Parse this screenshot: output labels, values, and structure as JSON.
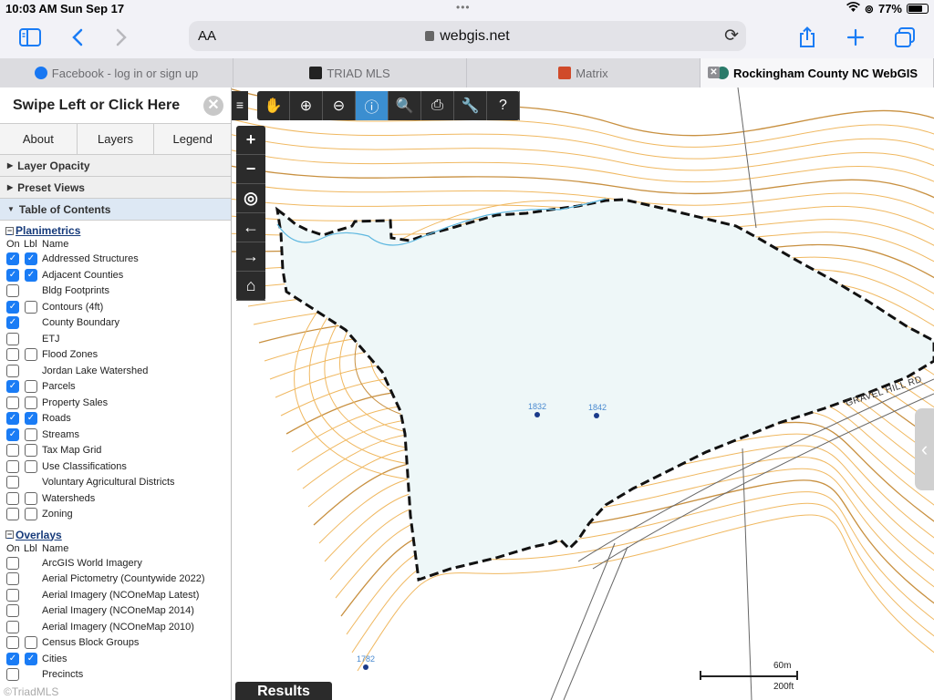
{
  "status": {
    "time": "10:03 AM",
    "date": "Sun Sep 17",
    "battery": "77%",
    "dots": "•••"
  },
  "toolbar": {
    "aa": "AA",
    "url": "webgis.net",
    "reload_icon": "⟳"
  },
  "tabs": [
    {
      "label": "Facebook - log in or sign up",
      "color": "#1877f2"
    },
    {
      "label": "TRIAD MLS",
      "color": "#222222"
    },
    {
      "label": "Matrix",
      "color": "#d04a2a"
    },
    {
      "label": "Rockingham County NC WebGIS",
      "color": "#2a7a6a"
    }
  ],
  "panel": {
    "title": "Swipe Left or Click Here",
    "tabs": [
      "About",
      "Layers",
      "Legend"
    ],
    "accordions": [
      "Layer Opacity",
      "Preset Views",
      "Table of Contents"
    ],
    "planimetrics": {
      "title": "Planimetrics",
      "headers": {
        "on": "On",
        "lbl": "Lbl",
        "name": "Name"
      },
      "layers": [
        {
          "name": "Addressed Structures",
          "on": true,
          "lbl": true
        },
        {
          "name": "Adjacent Counties",
          "on": true,
          "lbl": true
        },
        {
          "name": "Bldg Footprints",
          "on": false,
          "lbl": null
        },
        {
          "name": "Contours (4ft)",
          "on": true,
          "lbl": false
        },
        {
          "name": "County Boundary",
          "on": true,
          "lbl": null
        },
        {
          "name": "ETJ",
          "on": false,
          "lbl": null
        },
        {
          "name": "Flood Zones",
          "on": false,
          "lbl": false
        },
        {
          "name": "Jordan Lake Watershed",
          "on": false,
          "lbl": null
        },
        {
          "name": "Parcels",
          "on": true,
          "lbl": false
        },
        {
          "name": "Property Sales",
          "on": false,
          "lbl": false
        },
        {
          "name": "Roads",
          "on": true,
          "lbl": true
        },
        {
          "name": "Streams",
          "on": true,
          "lbl": false
        },
        {
          "name": "Tax Map Grid",
          "on": false,
          "lbl": false
        },
        {
          "name": "Use Classifications",
          "on": false,
          "lbl": false
        },
        {
          "name": "Voluntary Agricultural Districts",
          "on": false,
          "lbl": null
        },
        {
          "name": "Watersheds",
          "on": false,
          "lbl": false
        },
        {
          "name": "Zoning",
          "on": false,
          "lbl": false
        }
      ]
    },
    "overlays": {
      "title": "Overlays",
      "headers": {
        "on": "On",
        "lbl": "Lbl",
        "name": "Name"
      },
      "layers": [
        {
          "name": "ArcGIS World Imagery",
          "on": false,
          "lbl": null
        },
        {
          "name": "Aerial Pictometry (Countywide 2022)",
          "on": false,
          "lbl": null
        },
        {
          "name": "Aerial Imagery (NCOneMap Latest)",
          "on": false,
          "lbl": null
        },
        {
          "name": "Aerial Imagery (NCOneMap 2014)",
          "on": false,
          "lbl": null
        },
        {
          "name": "Aerial Imagery (NCOneMap 2010)",
          "on": false,
          "lbl": null
        },
        {
          "name": "Census Block Groups",
          "on": false,
          "lbl": false
        },
        {
          "name": "Cities",
          "on": true,
          "lbl": true
        },
        {
          "name": "Precincts",
          "on": false,
          "lbl": null
        }
      ]
    }
  },
  "map": {
    "toolbar_icons": [
      "pan-icon",
      "zoom-in-icon",
      "zoom-out-icon",
      "identify-icon",
      "search-icon",
      "print-icon",
      "tools-icon",
      "help-icon"
    ],
    "toolbar_glyphs": [
      "✋",
      "⊕",
      "⊖",
      "ⓘ",
      "🔍",
      "⎙",
      "🔧",
      "?"
    ],
    "nav_glyphs": [
      "+",
      "−",
      "◎",
      "←",
      "→",
      "⌂"
    ],
    "address_labels": [
      "1832",
      "1842",
      "1782"
    ],
    "road_label": "GRAVEL HILL RD",
    "scale_m": "60m",
    "scale_ft": "200ft",
    "results": "Results",
    "menu_glyph": "≡",
    "side_glyph": "‹",
    "colors": {
      "contour": "#f0b860",
      "contour_index": "#c89040",
      "parcel_fill": "#eef7f8",
      "stream": "#5fb8e0"
    }
  },
  "watermark": "©TriadMLS"
}
